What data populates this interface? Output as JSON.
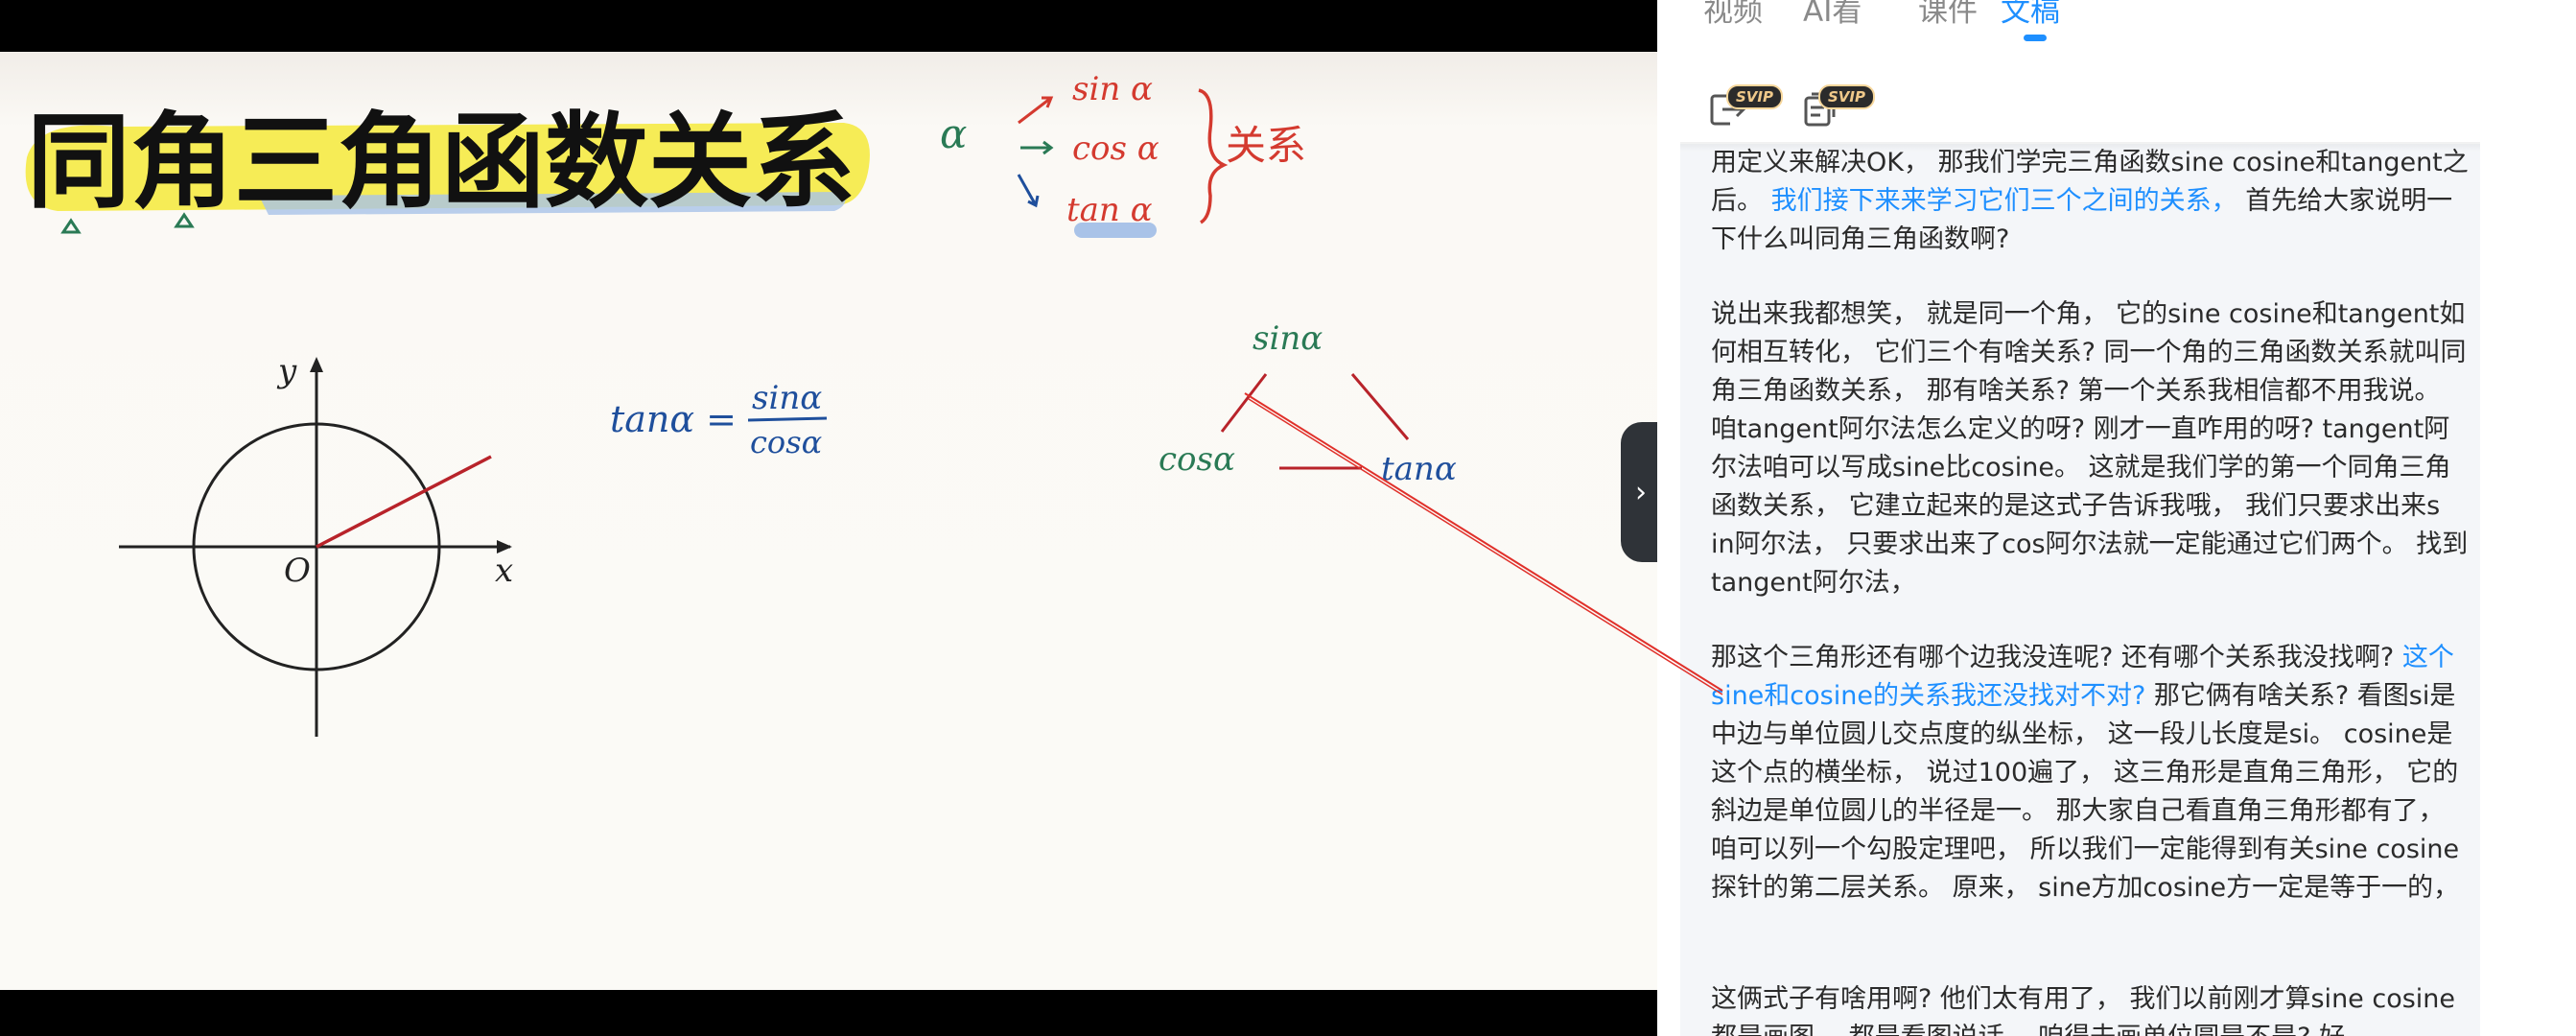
{
  "tabs": [
    {
      "label": "视频",
      "active": false
    },
    {
      "label": "AI看",
      "active": false
    },
    {
      "label": "课件",
      "active": false
    },
    {
      "label": "文稿",
      "active": true
    }
  ],
  "toolbar": {
    "export_icon": "export-icon",
    "copy_icon": "document-icon",
    "badge": "SVIP"
  },
  "slide": {
    "title": "同角三角函数关系",
    "alpha": "α",
    "sin": "sin α",
    "cos": "cos α",
    "tan": "tan α",
    "relation": "关系",
    "formula_lhs": "tanα =",
    "formula_num": "sinα",
    "formula_den": "cosα",
    "axis_y": "y",
    "axis_x": "x",
    "origin": "O",
    "tri_sin": "sinα",
    "tri_cos": "cosα",
    "tri_tan": "tanα"
  },
  "transcript": {
    "paragraphs": [
      [
        {
          "text": "用定义来解决OK， 那我们学完三角函数sine cosine和tangent之后。 ",
          "highlight": false
        },
        {
          "text": "我们接下来来学习它们三个之间的关系， ",
          "highlight": true
        },
        {
          "text": "首先给大家说明一下什么叫同角三角函数啊?",
          "highlight": false
        }
      ],
      [
        {
          "text": "说出来我都想笑， 就是同一个角， 它的sine cosine和tangent如何相互转化， 它们三个有啥关系? 同一个角的三角函数关系就叫同角三角函数关系， 那有啥关系? 第一个关系我相信都不用我说。 咱tangent阿尔法怎么定义的呀? 刚才一直咋用的呀? tangent阿尔法咱可以写成sine比cosine。 这就是我们学的第一个同角三角函数关系， 它建立起来的是这式子告诉我哦， 我们只要求出来s in阿尔法， 只要求出来了cos阿尔法就一定能通过它们两个。 找到tangent阿尔法，",
          "highlight": false
        }
      ],
      [
        {
          "text": "那这个三角形还有哪个边我没连呢? 还有哪个关系我没找啊? ",
          "highlight": false
        },
        {
          "text": "这个sine和cosine的关系我还没找对不对? ",
          "highlight": true
        },
        {
          "text": "那它俩有啥关系? 看图si是中边与单位圆儿交点度的纵坐标， 这一段儿长度是si。 cosine是这个点的横坐标， 说过100遍了， 这三角形是直角三角形， 它的斜边是单位圆儿的半径是一。 那大家自己看直角三角形都有了， 咱可以列一个勾股定理吧， 所以我们一定能得到有关sine cosine探针的第二层关系。 原来， sine方加cosine方一定是等于一的，",
          "highlight": false
        }
      ],
      [
        {
          "text": "这俩式子有啥用啊? 他们太有用了， 我们以前刚才算sine cosine都是画图， 都是看图说话， 咱得去画单位圆是不是? 好",
          "highlight": false
        }
      ]
    ]
  },
  "colors": {
    "accent": "#1e8fff",
    "annotation_red": "#d43a2f",
    "ink_green": "#2a7a55",
    "ink_blue": "#1f4f9c"
  }
}
